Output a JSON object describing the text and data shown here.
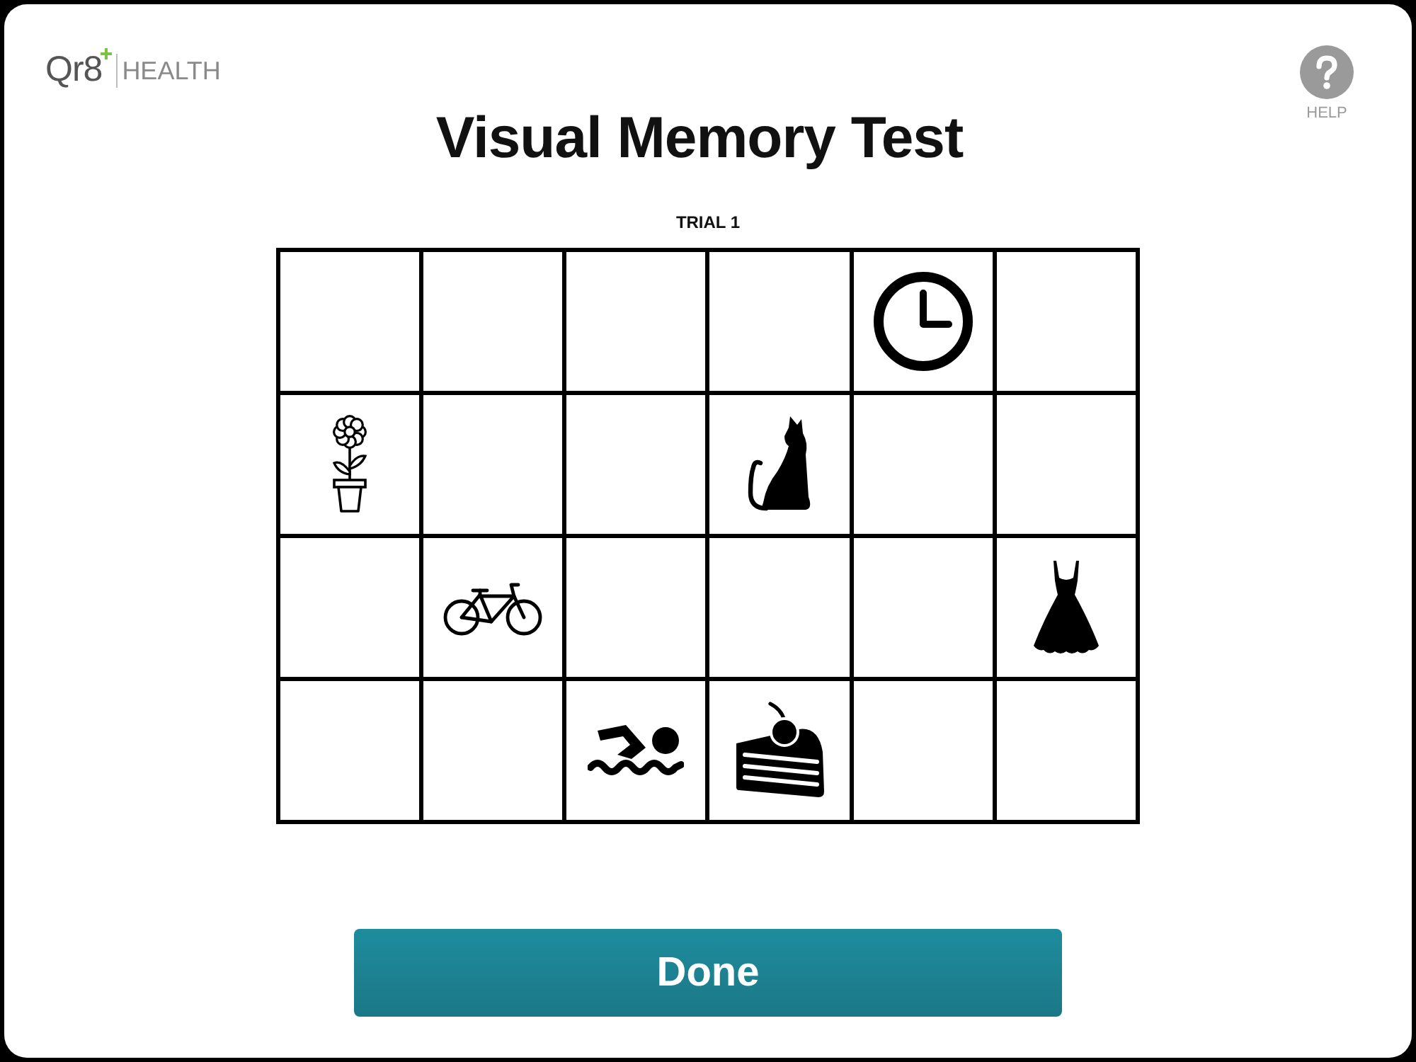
{
  "logo": {
    "name": "Qr8",
    "suffix": "HEALTH"
  },
  "help": {
    "label": "HELP"
  },
  "title": "Visual Memory Test",
  "trial": {
    "label": "TRIAL 1"
  },
  "grid": {
    "rows": [
      {
        "cells": [
          {
            "kind": "empty"
          },
          {
            "kind": "empty"
          },
          {
            "kind": "empty"
          },
          {
            "kind": "empty"
          },
          {
            "kind": "clock"
          },
          {
            "kind": "empty"
          }
        ]
      },
      {
        "cells": [
          {
            "kind": "flower"
          },
          {
            "kind": "empty"
          },
          {
            "kind": "empty"
          },
          {
            "kind": "cat"
          },
          {
            "kind": "empty"
          },
          {
            "kind": "empty"
          }
        ]
      },
      {
        "cells": [
          {
            "kind": "empty"
          },
          {
            "kind": "bicycle"
          },
          {
            "kind": "empty"
          },
          {
            "kind": "empty"
          },
          {
            "kind": "empty"
          },
          {
            "kind": "dress"
          }
        ]
      },
      {
        "cells": [
          {
            "kind": "empty"
          },
          {
            "kind": "empty"
          },
          {
            "kind": "swimmer"
          },
          {
            "kind": "cake"
          },
          {
            "kind": "empty"
          },
          {
            "kind": "empty"
          }
        ]
      }
    ]
  },
  "done_button": {
    "label": "Done"
  }
}
